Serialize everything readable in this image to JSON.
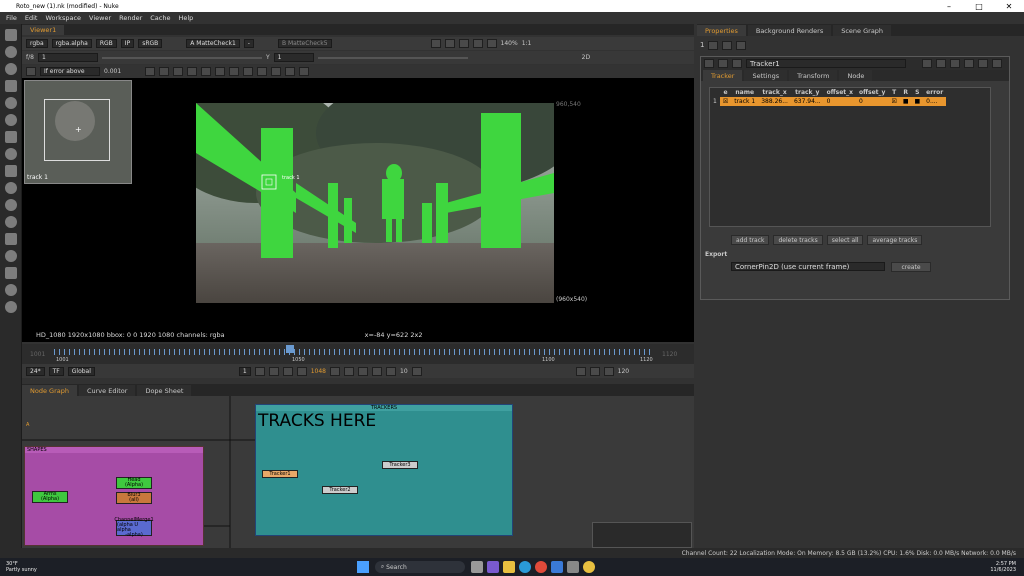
{
  "window": {
    "title": "Roto_new (1).nk (modified) - Nuke"
  },
  "menu": [
    "File",
    "Edit",
    "Workspace",
    "Viewer",
    "Render",
    "Cache",
    "Help"
  ],
  "viewer": {
    "tab": "Viewer1",
    "channels": "rgba",
    "channel_sel": "rgba.alpha",
    "colorspace": "RGB",
    "ip": "IP",
    "display": "sRGB",
    "a_input": "A  MatteCheck1",
    "a_op": "-",
    "b_input": "B  MatteCheck5",
    "zoom": "140%",
    "ratio": "1:1",
    "fstop": "f/8",
    "frame_num": "1",
    "gamma": "1",
    "y_val": "Y",
    "exposure": "1",
    "error_mode": "If error above",
    "error_val": "0.001",
    "mode_2d": "2D",
    "res_top": "960,540",
    "res_bottom": "(960x540)",
    "thumb_label": "track 1",
    "track_label": "track 1",
    "status_left": "HD_1080 1920x1080  bbox: 0 0 1920 1080 channels: rgba",
    "status_mid": "x=-84 y=622 2x2"
  },
  "timeline": {
    "start": "1001",
    "end": "1120",
    "tick_mid": "1050",
    "tick_right": "1100",
    "label_start": "1001",
    "label_end": "1120",
    "current_frame": "1048",
    "fps": "24*",
    "tf": "TF",
    "scope": "Global",
    "step": "10",
    "end_field": "120",
    "inc": "1"
  },
  "node_tabs": [
    "Node Graph",
    "Curve Editor",
    "Dope Sheet"
  ],
  "nodes": {
    "backdrop_trackers": "TRACKERS",
    "backdrop_shapes": "SHAPES",
    "big_label": "TRACKS HERE",
    "tracker1": "Tracker1",
    "tracker2": "Tracker2",
    "tracker3": "Tracker3",
    "head": "Head",
    "head_sub": "(Alpha)",
    "arms": "Arms",
    "arms_sub": "(Alpha)",
    "blur3": "Blur3",
    "blur3_sub": "(all)",
    "channel_merge": "ChannelMerge1",
    "channel_merge_sub": "(alpha U alpha",
    "channel_merge_sub2": "-alpha)",
    "small_a": "A"
  },
  "right_tabs": [
    "Properties",
    "Background Renders",
    "Scene Graph"
  ],
  "properties": {
    "count": "1",
    "node_name": "Tracker1",
    "tabs": [
      "Tracker",
      "Settings",
      "Transform",
      "Node"
    ],
    "columns": [
      "e",
      "name",
      "track_x",
      "track_y",
      "offset_x",
      "offset_y",
      "T",
      "R",
      "S",
      "error"
    ],
    "row": {
      "index": "1",
      "name": "track 1",
      "track_x": "388.26...",
      "track_y": "637.94...",
      "offset_x": "0",
      "offset_y": "0",
      "error": "0...."
    },
    "buttons": [
      "add track",
      "delete tracks",
      "select all",
      "average tracks"
    ],
    "export_label": "Export",
    "export_value": "CornerPin2D (use current frame)",
    "create": "create"
  },
  "status": {
    "text": "Channel Count: 22  Localization Mode: On  Memory: 8.5 GB (13.2%)  CPU: 1.6%  Disk: 0.0 MB/s  Network: 0.0 MB/s"
  },
  "taskbar": {
    "temp": "30°F",
    "weather": "Partly sunny",
    "search": "Search",
    "time": "2:57 PM",
    "date": "11/6/2023"
  },
  "colors": {
    "accent": "#e09a30",
    "tracker_bg": "#2f8f8f",
    "shapes_bg": "#a64ca6",
    "matte_green": "#3fd63f"
  }
}
